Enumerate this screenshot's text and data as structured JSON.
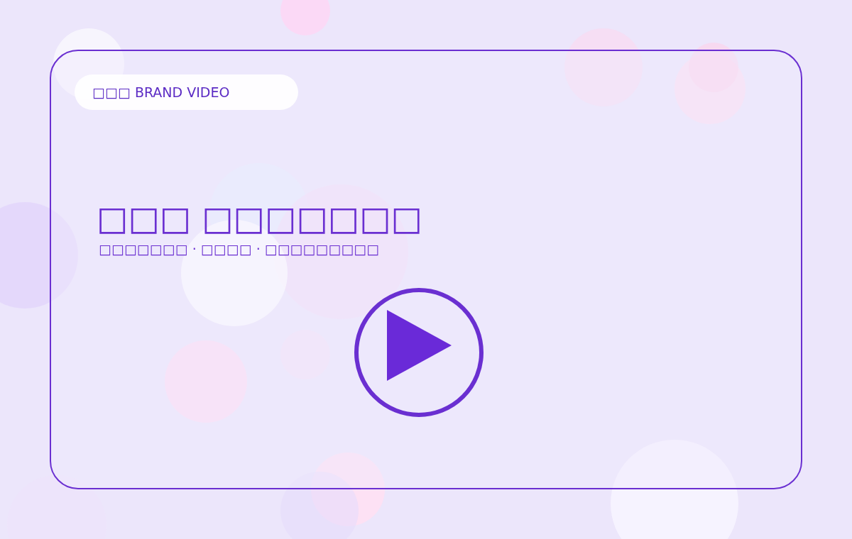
{
  "badge": {
    "label": "□□□ BRAND VIDEO"
  },
  "title": "□□□ □□□□□□□",
  "subtitle": "□□□□□□□ · □□□□ · □□□□□□□□□"
}
